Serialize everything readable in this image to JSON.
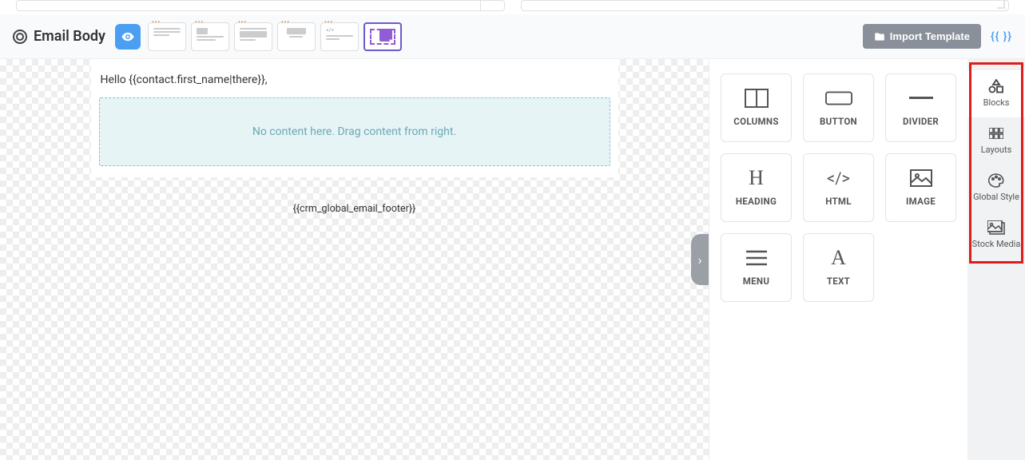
{
  "toolbar": {
    "title": "Email Body",
    "import_label": "Import Template",
    "token_label": "{{ }}",
    "layout_options": [
      "layout-1",
      "layout-2",
      "layout-3",
      "layout-4",
      "layout-5",
      "layout-select"
    ],
    "active_layout_index": 5
  },
  "canvas": {
    "greeting": "Hello {{contact.first_name|there}},",
    "dropzone_text": "No content here. Drag content from right.",
    "footer_token": "{{crm_global_email_footer}}"
  },
  "blocks": [
    {
      "key": "columns",
      "label": "COLUMNS",
      "icon": "columns-icon"
    },
    {
      "key": "button",
      "label": "BUTTON",
      "icon": "button-icon"
    },
    {
      "key": "divider",
      "label": "DIVIDER",
      "icon": "divider-icon"
    },
    {
      "key": "heading",
      "label": "HEADING",
      "icon": "heading-icon"
    },
    {
      "key": "html",
      "label": "HTML",
      "icon": "html-icon"
    },
    {
      "key": "image",
      "label": "IMAGE",
      "icon": "image-icon"
    },
    {
      "key": "menu",
      "label": "MENU",
      "icon": "menu-icon"
    },
    {
      "key": "text",
      "label": "TEXT",
      "icon": "text-icon"
    }
  ],
  "side_tabs": [
    {
      "key": "blocks",
      "label": "Blocks",
      "icon": "shapes-icon",
      "active": true
    },
    {
      "key": "layouts",
      "label": "Layouts",
      "icon": "grid-icon",
      "active": false
    },
    {
      "key": "global_style",
      "label": "Global Style",
      "icon": "palette-icon",
      "active": false
    },
    {
      "key": "stock_media",
      "label": "Stock Media",
      "icon": "media-icon",
      "active": false
    }
  ],
  "collapse_arrow": "›"
}
